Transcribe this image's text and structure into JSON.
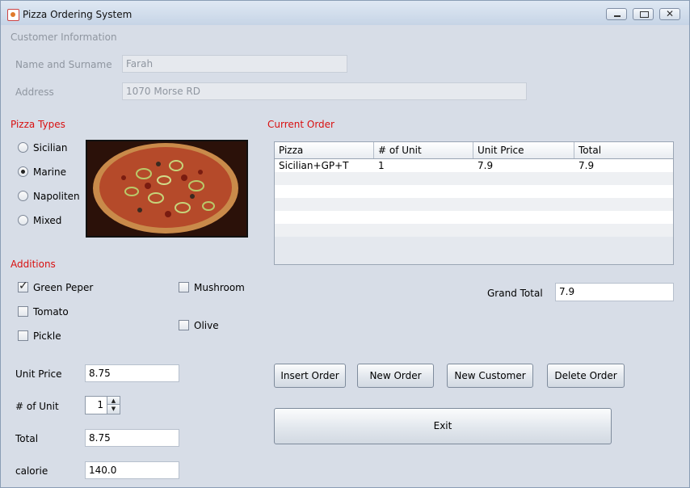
{
  "window": {
    "title": "Pizza Ordering System"
  },
  "customer": {
    "section_label": "Customer Information",
    "name_label": "Name and Surname",
    "name_value": "Farah",
    "address_label": "Address",
    "address_value": "1070 Morse RD"
  },
  "pizza_types": {
    "label": "Pizza Types",
    "options": [
      "Sicilian",
      "Marine",
      "Napoliten",
      "Mixed"
    ],
    "selected": "Marine"
  },
  "additions": {
    "label": "Additions",
    "items": [
      {
        "label": "Green Peper",
        "checked": true
      },
      {
        "label": "Tomato",
        "checked": false
      },
      {
        "label": "Pickle",
        "checked": false
      },
      {
        "label": "Mushroom",
        "checked": false
      },
      {
        "label": "Olive",
        "checked": false
      }
    ]
  },
  "order": {
    "label": "Current Order",
    "columns": [
      "Pizza",
      "# of Unit",
      "Unit Price",
      "Total"
    ],
    "rows": [
      [
        "Sicilian+GP+T",
        "1",
        "7.9",
        "7.9"
      ]
    ]
  },
  "grand_total": {
    "label": "Grand Total",
    "value": "7.9"
  },
  "buttons": {
    "insert": "Insert Order",
    "new_order": "New Order",
    "new_customer": "New Customer",
    "delete": "Delete Order",
    "exit": "Exit"
  },
  "pricing": {
    "unit_price_label": "Unit Price",
    "unit_price_value": "8.75",
    "units_label": "# of Unit",
    "units_value": "1",
    "total_label": "Total",
    "total_value": "8.75",
    "calorie_label": "calorie",
    "calorie_value": "140.0"
  }
}
